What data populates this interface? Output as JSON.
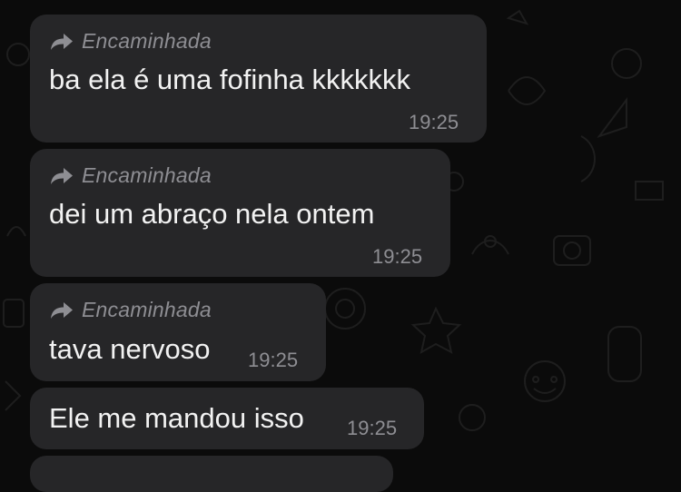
{
  "colors": {
    "background": "#0b0b0b",
    "bubble": "#262628",
    "text": "#f2f2f2",
    "meta": "#8e8e93"
  },
  "messages": [
    {
      "forwarded_label": "Encaminhada",
      "forwarded_icon": "forward-arrow-icon",
      "text": "ba ela é uma fofinha kkkkkkk",
      "time": "19:25"
    },
    {
      "forwarded_label": "Encaminhada",
      "forwarded_icon": "forward-arrow-icon",
      "text": "dei um abraço nela ontem",
      "time": "19:25"
    },
    {
      "forwarded_label": "Encaminhada",
      "forwarded_icon": "forward-arrow-icon",
      "text": "tava nervoso",
      "time": "19:25"
    },
    {
      "text": "Ele me mandou isso",
      "time": "19:25"
    }
  ]
}
